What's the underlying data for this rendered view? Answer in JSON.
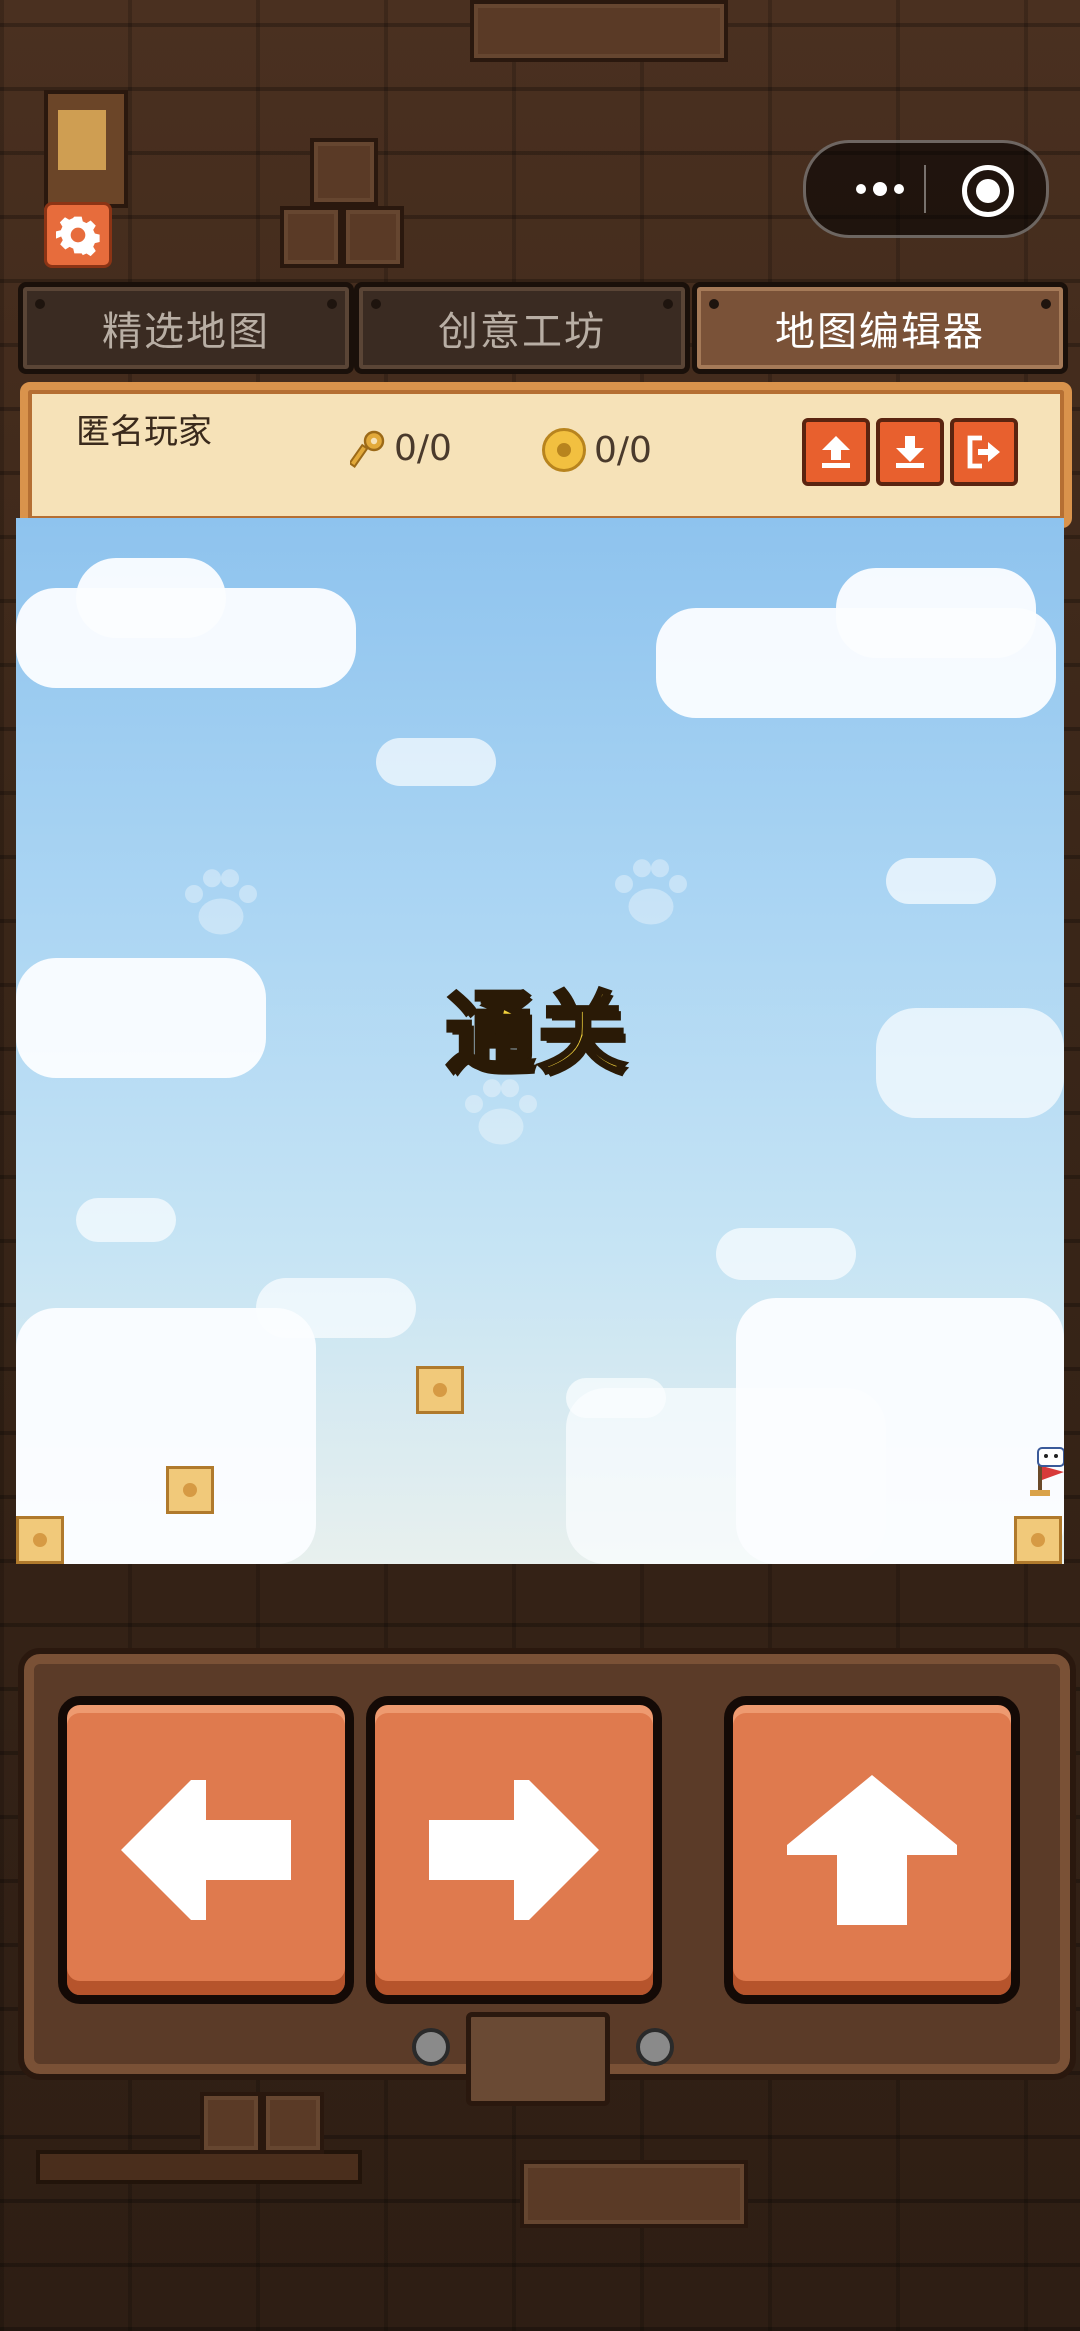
{
  "tabs": [
    {
      "label": "精选地图",
      "active": false
    },
    {
      "label": "创意工坊",
      "active": false
    },
    {
      "label": "地图编辑器",
      "active": true
    }
  ],
  "player": {
    "name": "匿名玩家",
    "keys": "0/0",
    "coins": "0/0"
  },
  "actions": {
    "upload": "upload-icon",
    "download": "download-icon",
    "exit": "exit-icon"
  },
  "game": {
    "status_text": "通关"
  },
  "controls": {
    "left": "arrow-left-icon",
    "right": "arrow-right-icon",
    "jump": "arrow-up-icon"
  },
  "colors": {
    "accent": "#e8602e",
    "button": "#df7a4e",
    "panel": "#f6e2b8",
    "clear_text": "#f2d23c"
  }
}
